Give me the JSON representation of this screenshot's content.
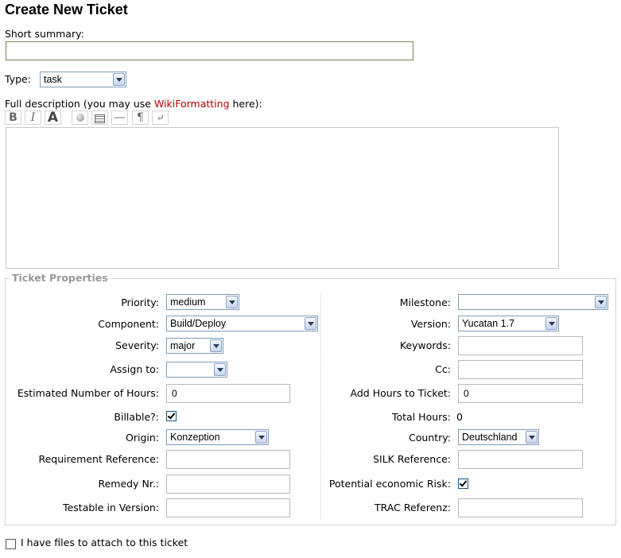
{
  "page": {
    "title": "Create New Ticket"
  },
  "summary": {
    "label": "Short summary:",
    "value": ""
  },
  "type": {
    "label": "Type:",
    "value": "task"
  },
  "description": {
    "label_before": "Full description (you may use ",
    "link": "WikiFormatting",
    "label_after": " here):",
    "value": ""
  },
  "toolbar": {
    "bold": "B",
    "italic": "I",
    "heading": "A",
    "hr": "—",
    "paragraph": "¶",
    "linebreak": "↵"
  },
  "properties": {
    "legend": "Ticket Properties",
    "priority": {
      "label": "Priority:",
      "value": "medium"
    },
    "component": {
      "label": "Component:",
      "value": "Build/Deploy"
    },
    "severity": {
      "label": "Severity:",
      "value": "major"
    },
    "assign_to": {
      "label": "Assign to:",
      "value": ""
    },
    "estimated_hours": {
      "label": "Estimated Number of Hours:",
      "value": "0"
    },
    "billable": {
      "label": "Billable?:",
      "checked": true
    },
    "origin": {
      "label": "Origin:",
      "value": "Konzeption"
    },
    "requirement_reference": {
      "label": "Requirement Reference:",
      "value": ""
    },
    "remedy_nr": {
      "label": "Remedy Nr.:",
      "value": ""
    },
    "testable_in_version": {
      "label": "Testable in Version:",
      "value": ""
    },
    "milestone": {
      "label": "Milestone:",
      "value": ""
    },
    "version": {
      "label": "Version:",
      "value": "Yucatan 1.7"
    },
    "keywords": {
      "label": "Keywords:",
      "value": ""
    },
    "cc": {
      "label": "Cc:",
      "value": ""
    },
    "add_hours": {
      "label": "Add Hours to Ticket:",
      "value": "0"
    },
    "total_hours": {
      "label": "Total Hours:",
      "value": "0"
    },
    "country": {
      "label": "Country:",
      "value": "Deutschland"
    },
    "silk_reference": {
      "label": "SILK Reference:",
      "value": ""
    },
    "economic_risk": {
      "label": "Potential economic Risk:",
      "checked": true
    },
    "trac_referenz": {
      "label": "TRAC Referenz:",
      "value": ""
    }
  },
  "attach": {
    "label": "I have files to attach to this ticket",
    "checked": false
  }
}
